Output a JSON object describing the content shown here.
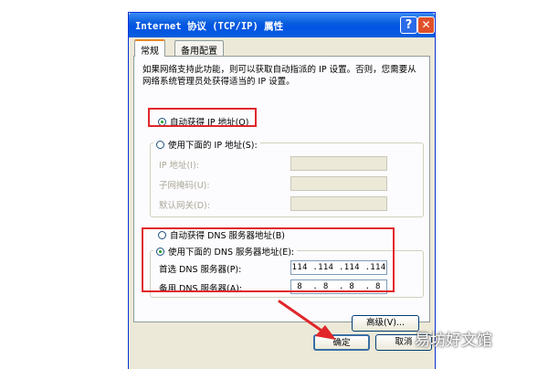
{
  "window": {
    "title": "Internet 协议 (TCP/IP) 属性",
    "help_glyph": "?",
    "close_glyph": "✕"
  },
  "tabs": [
    {
      "label": "常规",
      "active": true
    },
    {
      "label": "备用配置",
      "active": false
    }
  ],
  "intro_text": "如果网络支持此功能，则可以获取自动指派的 IP 设置。否则，您需要从网络系统管理员处获得适当的 IP 设置。",
  "ip_section": {
    "auto_label": "自动获得 IP 地址(O)",
    "auto_selected": true,
    "manual_label": "使用下面的 IP 地址(S):",
    "fields": [
      {
        "label": "IP 地址(I):",
        "value": ""
      },
      {
        "label": "子网掩码(U):",
        "value": ""
      },
      {
        "label": "默认网关(D):",
        "value": ""
      }
    ]
  },
  "dns_section": {
    "auto_label": "自动获得 DNS 服务器地址(B)",
    "manual_label": "使用下面的 DNS 服务器地址(E):",
    "manual_selected": true,
    "fields": [
      {
        "label": "首选 DNS 服务器(P):",
        "value": "114 .114 .114 .114"
      },
      {
        "label": "备用 DNS 服务器(A):",
        "value": "8  . 8  . 8  . 8"
      }
    ]
  },
  "buttons": {
    "advanced": "高级(V)...",
    "ok": "确定",
    "cancel": "取消"
  },
  "watermark": "易坊好文馆",
  "colors": {
    "titlebar": "#0054e3",
    "dialog_bg": "#ece9d8",
    "highlight": "#e0262b"
  }
}
